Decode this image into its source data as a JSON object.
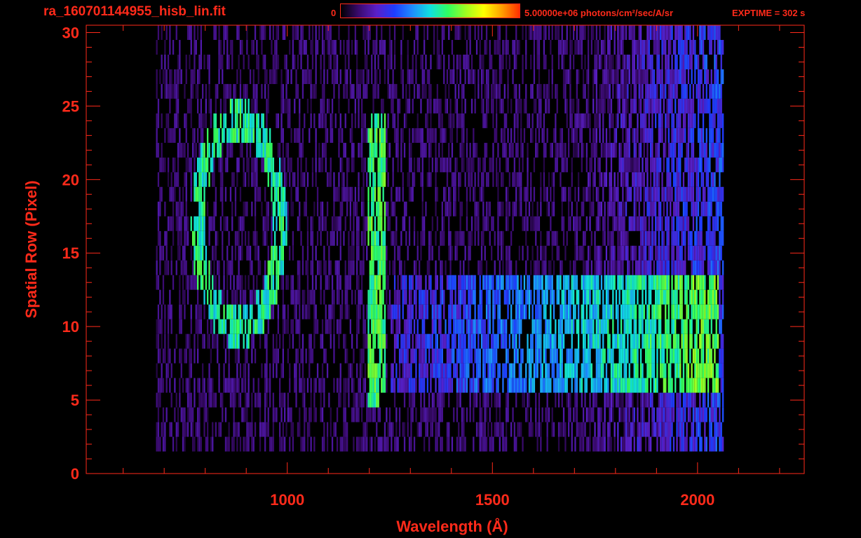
{
  "header": {
    "filename": "ra_160701144955_hisb_lin.fit",
    "colorbar_min": "0",
    "colorbar_max_label": "5.00000e+06 photons/cm²/sec/A/sr",
    "exptime": "EXPTIME = 302 s"
  },
  "colors": {
    "axis": "#ff2a1a",
    "background": "#000000",
    "colormap": [
      "#000000",
      "#3a0a6e",
      "#5a1fc8",
      "#1e3cff",
      "#1e8cff",
      "#10e0e0",
      "#30ff60",
      "#a0ff20",
      "#ffff00",
      "#ffa000",
      "#ff3000"
    ]
  },
  "chart_data": {
    "type": "heatmap",
    "title": "",
    "xlabel": "Wavelength (Å)",
    "ylabel": "Spatial Row (Pixel)",
    "xlim": [
      510,
      2260
    ],
    "ylim": [
      0,
      30.5
    ],
    "xticks": [
      1000,
      1500,
      2000
    ],
    "yticks": [
      0,
      5,
      10,
      15,
      20,
      25,
      30
    ],
    "colorbar_range": [
      0,
      5000000
    ],
    "data_extent": {
      "x": [
        680,
        2060
      ],
      "y": [
        2,
        30
      ]
    },
    "features": [
      {
        "kind": "loop",
        "x_center": 880,
        "y_center": 17,
        "x_halfwidth": 100,
        "y_halfwidth": 7,
        "level": 0.55
      },
      {
        "kind": "vertical_line",
        "x": 1215,
        "y": [
          5,
          24
        ],
        "level": 0.6
      },
      {
        "kind": "band",
        "y": [
          6,
          13
        ],
        "x": [
          1250,
          2050
        ],
        "level": 0.45
      }
    ]
  }
}
